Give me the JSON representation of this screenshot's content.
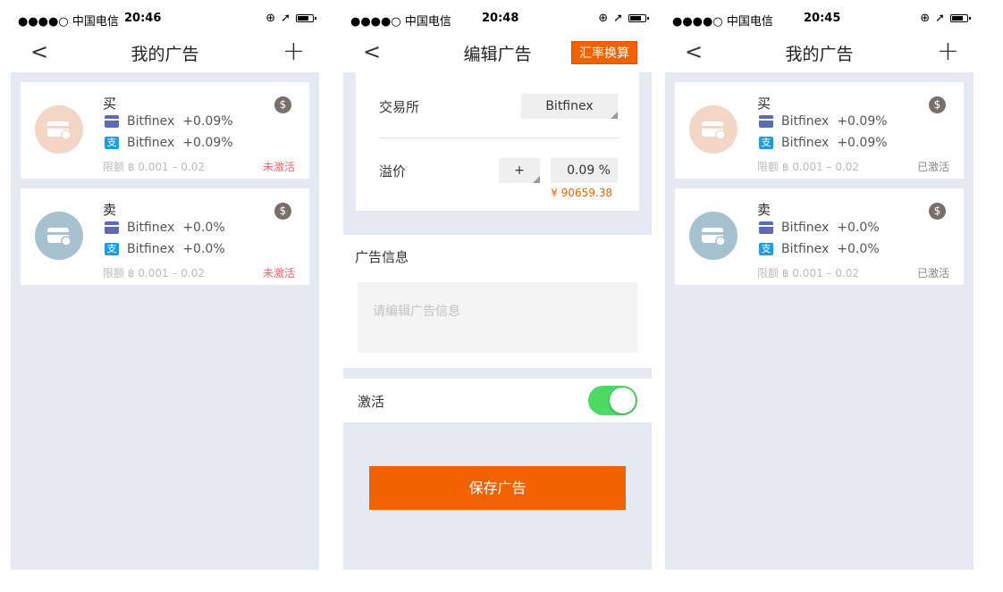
{
  "status_bars": [
    {
      "carrier": "●●●●○ 中国电信",
      "time": "20:46"
    },
    {
      "carrier": "●●●●○ 中国电信",
      "time": "20:48"
    },
    {
      "carrier": "●●●●○ 中国电信",
      "time": "20:45"
    }
  ],
  "screen1": {
    "title": "我的广告",
    "back_icon": "<",
    "add_icon": "+",
    "ads": [
      {
        "type": "买",
        "coin_symbol": "$",
        "methods": [
          {
            "icon": "bank-card-icon",
            "exchange": "Bitfinex",
            "rate": "+0.09%"
          },
          {
            "icon": "alipay-icon",
            "exchange": "Bitfinex",
            "rate": "+0.09%"
          }
        ],
        "limit": "限额 ฿ 0.001 – 0.02",
        "status": "未激活",
        "status_color": "#f0666a",
        "avatar_color": "#f3d6c6"
      },
      {
        "type": "卖",
        "coin_symbol": "$",
        "methods": [
          {
            "icon": "bank-card-icon",
            "exchange": "Bitfinex",
            "rate": "+0.0%"
          },
          {
            "icon": "alipay-icon",
            "exchange": "Bitfinex",
            "rate": "+0.0%"
          }
        ],
        "limit": "限额 ฿ 0.001 – 0.02",
        "status": "未激活",
        "status_color": "#f0666a",
        "avatar_color": "#a7c1d1"
      }
    ]
  },
  "screen2": {
    "title": "编辑广告",
    "back_icon": "<",
    "rate_button": "汇率换算",
    "exchange_label": "交易所",
    "exchange_value": "Bitfinex",
    "premium_label": "溢价",
    "premium_sign": "+",
    "premium_value": "0.09 %",
    "premium_price": "¥ 90659.38",
    "ad_info_label": "广告信息",
    "ad_info_placeholder": "请编辑广告信息",
    "activate_label": "激活",
    "activate_on": true,
    "save_button": "保存广告",
    "accent_color": "#f06300",
    "toggle_color": "#4cd964"
  },
  "screen3": {
    "title": "我的广告",
    "back_icon": "<",
    "add_icon": "+",
    "ads": [
      {
        "type": "买",
        "coin_symbol": "$",
        "methods": [
          {
            "icon": "bank-card-icon",
            "exchange": "Bitfinex",
            "rate": "+0.09%"
          },
          {
            "icon": "alipay-icon",
            "exchange": "Bitfinex",
            "rate": "+0.09%"
          }
        ],
        "limit": "限额 ฿ 0.001 – 0.02",
        "status": "已激活",
        "status_color": "#888888",
        "avatar_color": "#f3d6c6"
      },
      {
        "type": "卖",
        "coin_symbol": "$",
        "methods": [
          {
            "icon": "bank-card-icon",
            "exchange": "Bitfinex",
            "rate": "+0.0%"
          },
          {
            "icon": "alipay-icon",
            "exchange": "Bitfinex",
            "rate": "+0.0%"
          }
        ],
        "limit": "限额 ฿ 0.001 – 0.02",
        "status": "已激活",
        "status_color": "#888888",
        "avatar_color": "#a7c1d1"
      }
    ]
  }
}
